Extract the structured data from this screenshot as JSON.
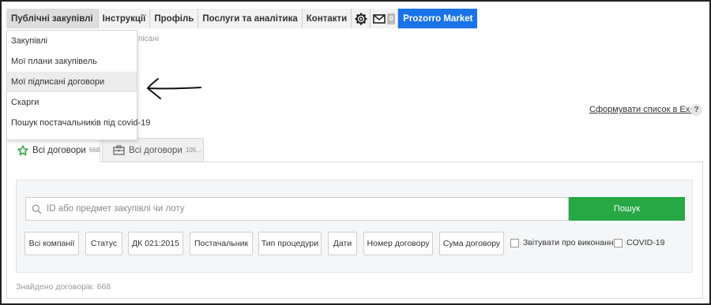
{
  "nav": {
    "items": [
      {
        "label": "Публічні закупівлі"
      },
      {
        "label": "Інструкції"
      },
      {
        "label": "Профіль"
      },
      {
        "label": "Послуги та аналітика"
      },
      {
        "label": "Контакти"
      }
    ],
    "mail_badge": "0",
    "market_label": "Prozorro Market"
  },
  "dropdown": {
    "items": [
      {
        "label": "Закупівлі"
      },
      {
        "label": "Мої плани закупівель"
      },
      {
        "label": "Мої підписані договори"
      },
      {
        "label": "Скарги"
      },
      {
        "label": "Пошук постачальників під covid-19"
      }
    ]
  },
  "breadcrumb_tail": "пісані",
  "excel_link": "Сформувати список в Excel",
  "help_label": "?",
  "tabs": [
    {
      "label": "Всі договори",
      "count": "668"
    },
    {
      "label": "Всі договори",
      "count": "105..."
    }
  ],
  "search": {
    "placeholder": "ID або предмет закупівлі чи лоту",
    "button": "Пошук"
  },
  "filters": [
    {
      "label": "Всі компанії"
    },
    {
      "label": "Статус"
    },
    {
      "label": "ДК 021:2015"
    },
    {
      "label": "Постачальник"
    },
    {
      "label": "Тип процедури"
    },
    {
      "label": "Дати"
    },
    {
      "label": "Номер договору"
    },
    {
      "label": "Сума договору"
    }
  ],
  "checkboxes": [
    {
      "label": "Звітувати про виконання"
    },
    {
      "label": "COVID-19"
    }
  ],
  "found_text": "Знайдено договорів: 668",
  "colors": {
    "accent_blue": "#1a73e8",
    "search_green": "#28a745",
    "star_green": "#28a745"
  }
}
